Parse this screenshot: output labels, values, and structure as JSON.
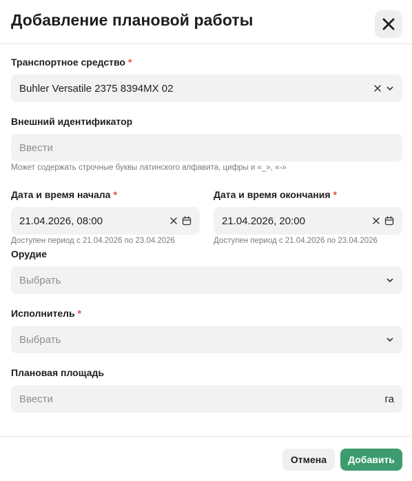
{
  "dialog": {
    "title": "Добавление плановой работы"
  },
  "vehicle": {
    "label": "Транспортное средство",
    "required_mark": "*",
    "value": "Buhler Versatile 2375 8394MX 02"
  },
  "external_id": {
    "label": "Внешний идентификатор",
    "placeholder": "Ввести",
    "hint": "Может содержать строчные буквы латинского алфавита, цифры и «_», «-»"
  },
  "start": {
    "label": "Дата и время начала",
    "required_mark": "*",
    "value": "21.04.2026, 08:00",
    "hint": "Доступен период с 21.04.2026 по 23.04.2026"
  },
  "end": {
    "label": "Дата и время окончания",
    "required_mark": "*",
    "value": "21.04.2026, 20:00",
    "hint": "Доступен период с 21.04.2026 по 23.04.2026"
  },
  "tool": {
    "label": "Орудие",
    "placeholder": "Выбрать"
  },
  "executor": {
    "label": "Исполнитель",
    "required_mark": "*",
    "placeholder": "Выбрать"
  },
  "area": {
    "label": "Плановая площадь",
    "placeholder": "Ввести",
    "unit": "га"
  },
  "footer": {
    "cancel_label": "Отмена",
    "submit_label": "Добавить"
  },
  "colors": {
    "accent": "#3d9c6f",
    "required": "#e5483d",
    "field_bg": "#f2f2f2"
  },
  "icons": {
    "close": "close-icon",
    "clear": "clear-icon",
    "chevron": "chevron-down-icon",
    "calendar": "calendar-icon"
  }
}
